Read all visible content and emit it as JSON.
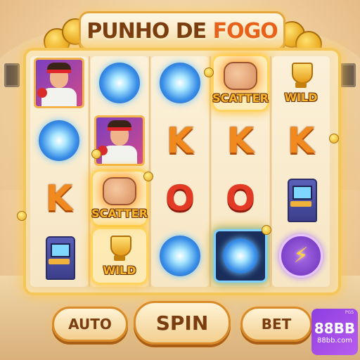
{
  "title": {
    "part1": "PUNHO DE ",
    "part2": "FOGO"
  },
  "grid": [
    [
      {
        "symbol": "fighter",
        "highlight": false
      },
      {
        "symbol": "orb",
        "highlight": false
      },
      {
        "symbol": "K",
        "highlight": false
      },
      {
        "symbol": "arcade",
        "highlight": false
      }
    ],
    [
      {
        "symbol": "orb",
        "highlight": false
      },
      {
        "symbol": "fighter",
        "highlight": false
      },
      {
        "symbol": "scatter",
        "label": "SCATTER",
        "highlight": true
      },
      {
        "symbol": "wild",
        "label": "WILD",
        "highlight": true
      }
    ],
    [
      {
        "symbol": "orb",
        "highlight": false
      },
      {
        "symbol": "K",
        "highlight": false
      },
      {
        "symbol": "O",
        "highlight": false
      },
      {
        "symbol": "orb",
        "highlight": false
      }
    ],
    [
      {
        "symbol": "scatter",
        "label": "SCATTER",
        "highlight": true
      },
      {
        "symbol": "K",
        "highlight": false
      },
      {
        "symbol": "O",
        "highlight": false
      },
      {
        "symbol": "orb-framed",
        "highlight": true
      }
    ],
    [
      {
        "symbol": "wild",
        "label": "WILD",
        "highlight": false
      },
      {
        "symbol": "K",
        "highlight": false
      },
      {
        "symbol": "arcade",
        "highlight": false
      },
      {
        "symbol": "lightning",
        "highlight": false
      }
    ]
  ],
  "controls": {
    "auto": "AUTO",
    "spin": "SPIN",
    "bet": "BET"
  },
  "brand": {
    "main": "88BB",
    "sub": "88bb.com",
    "corner": "PGS"
  },
  "colors": {
    "accent_gold": "#f4c65a",
    "brand_purple": "#9b4de8",
    "title_fire": "#e8611b"
  }
}
